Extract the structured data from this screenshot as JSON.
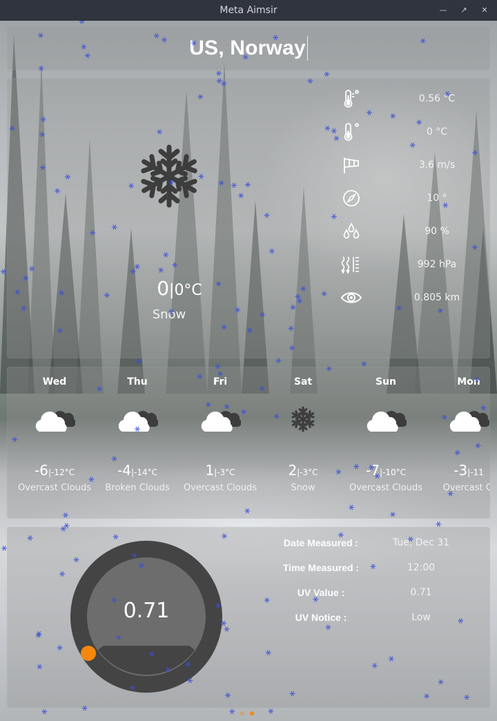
{
  "window": {
    "title": "Meta Aimsir"
  },
  "search": {
    "location": "US, Norway"
  },
  "current": {
    "temp": "0",
    "feels_like": "0°C",
    "description": "Snow",
    "icon": "snowflake-icon",
    "stats": [
      {
        "icon": "thermometer-icon",
        "value": "0.56 °C"
      },
      {
        "icon": "thermometer-icon",
        "value": "0 °C"
      },
      {
        "icon": "windsock-icon",
        "value": "3.6 m/s"
      },
      {
        "icon": "compass-icon",
        "value": "10 °"
      },
      {
        "icon": "humidity-drops-icon",
        "value": "90 %"
      },
      {
        "icon": "pressure-icon",
        "value": "992 hPa"
      },
      {
        "icon": "eye-icon",
        "value": "0.805 km"
      }
    ]
  },
  "forecast": [
    {
      "day": "Wed",
      "hi": "-6",
      "lo": "-12°C",
      "desc": "Overcast Clouds",
      "icon": "cloud-icon"
    },
    {
      "day": "Thu",
      "hi": "-4",
      "lo": "-14°C",
      "desc": "Broken Clouds",
      "icon": "cloud-icon"
    },
    {
      "day": "Fri",
      "hi": "1",
      "lo": "-3°C",
      "desc": "Overcast Clouds",
      "icon": "cloud-icon"
    },
    {
      "day": "Sat",
      "hi": "2",
      "lo": "-3°C",
      "desc": "Snow",
      "icon": "snowflake-icon"
    },
    {
      "day": "Sun",
      "hi": "-7",
      "lo": "-10°C",
      "desc": "Overcast Clouds",
      "icon": "cloud-icon"
    },
    {
      "day": "Mon",
      "hi": "-3",
      "lo": "-11",
      "desc": "Overcast Cl",
      "icon": "cloud-icon"
    }
  ],
  "uv": {
    "value": "0.71",
    "level_fraction": 0.06,
    "rows": [
      {
        "label": "Date Measured :",
        "value": "Tue, Dec 31"
      },
      {
        "label": "Time Measured :",
        "value": "12:00"
      },
      {
        "label": "UV Value :",
        "value": "0.71"
      },
      {
        "label": "UV Notice :",
        "value": "Low"
      }
    ]
  },
  "pager": {
    "pages": 2,
    "active": 2
  },
  "colors": {
    "accent": "#f5870d",
    "icon_dark": "#3d3d3d",
    "gauge_ring": "#444444",
    "gauge_face": "#6d6d6d"
  }
}
